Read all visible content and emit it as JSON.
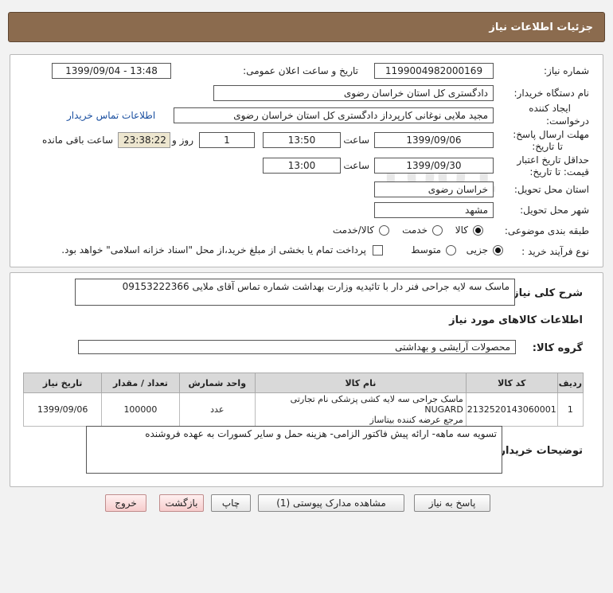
{
  "header": {
    "title": "جزئیات اطلاعات نیاز"
  },
  "form": {
    "need_number_label": "شماره نیاز:",
    "need_number": "1199004982000169",
    "announce_label": "تاریخ و ساعت اعلان عمومی:",
    "announce_value": "1399/09/04 - 13:48",
    "buyer_label": "نام دستگاه خریدار:",
    "buyer_value": "دادگستری کل استان خراسان رضوی",
    "creator_label_1": "ایجاد کننده",
    "creator_label_2": "درخواست:",
    "creator_value": "مجید ملایی نوغانی کارپرداز دادگستری کل استان خراسان رضوی",
    "contact_link": "اطلاعات تماس خریدار",
    "reply_label_1": "مهلت ارسال پاسخ:",
    "reply_label_2": "تا تاریخ:",
    "reply_date": "1399/09/06",
    "time_label": "ساعت",
    "reply_time": "13:50",
    "days_value": "1",
    "days_label": "روز و",
    "remaining_time": "23:38:22",
    "remaining_label": "ساعت باقی مانده",
    "validity_label_1": "حداقل تاریخ اعتبار",
    "validity_label_2": "قیمت: تا تاریخ:",
    "validity_date": "1399/09/30",
    "validity_time": "13:00",
    "province_label": "استان محل تحویل:",
    "province_value": "خراسان رضوی",
    "city_label": "شهر محل تحویل:",
    "city_value": "مشهد",
    "category_label": "طبقه بندی موضوعی:",
    "category_options": [
      "کالا",
      "خدمت",
      "کالا/خدمت"
    ],
    "process_label": "نوع فرآیند خرید :",
    "process_options": [
      "جزیی",
      "متوسط"
    ],
    "payment_note": "پرداخت تمام یا بخشی از مبلغ خرید،از محل \"اسناد خزانه اسلامی\" خواهد بود."
  },
  "description": {
    "label": "شرح کلی نیاز:",
    "value": "ماسک سه لایه جراحی فنر دار با تائیدیه وزارت بهداشت شماره تماس آقای ملایی 09153222366"
  },
  "goods": {
    "section_title": "اطلاعات کالاهای مورد نیاز",
    "group_label": "گروه کالا:",
    "group_value": "محصولات آرایشی و بهداشتی",
    "columns": [
      "ردیف",
      "کد کالا",
      "نام کالا",
      "واحد شمارش",
      "تعداد / مقدار",
      "تاریخ نیاز"
    ],
    "rows": [
      {
        "row": "1",
        "code": "2132520143060001",
        "name_line1": "ماسک جراحی سه لایه کشی پزشکی نام تجارتی NUGARD",
        "name_line2": "مرجع عرضه کننده بیتاساز",
        "unit": "عدد",
        "qty": "100000",
        "date": "1399/09/06"
      }
    ]
  },
  "buyer_notes": {
    "label": "توضیحات خریدار:",
    "value": "تسویه سه ماهه- ارائه پیش فاکتور الزامی- هزینه حمل و سایر کسورات به عهده فروشنده"
  },
  "buttons": {
    "reply": "پاسخ به نیاز",
    "attachments": "مشاهده مدارک پیوستی (1)",
    "print": "چاپ",
    "back": "بازگشت",
    "exit": "خروج"
  }
}
